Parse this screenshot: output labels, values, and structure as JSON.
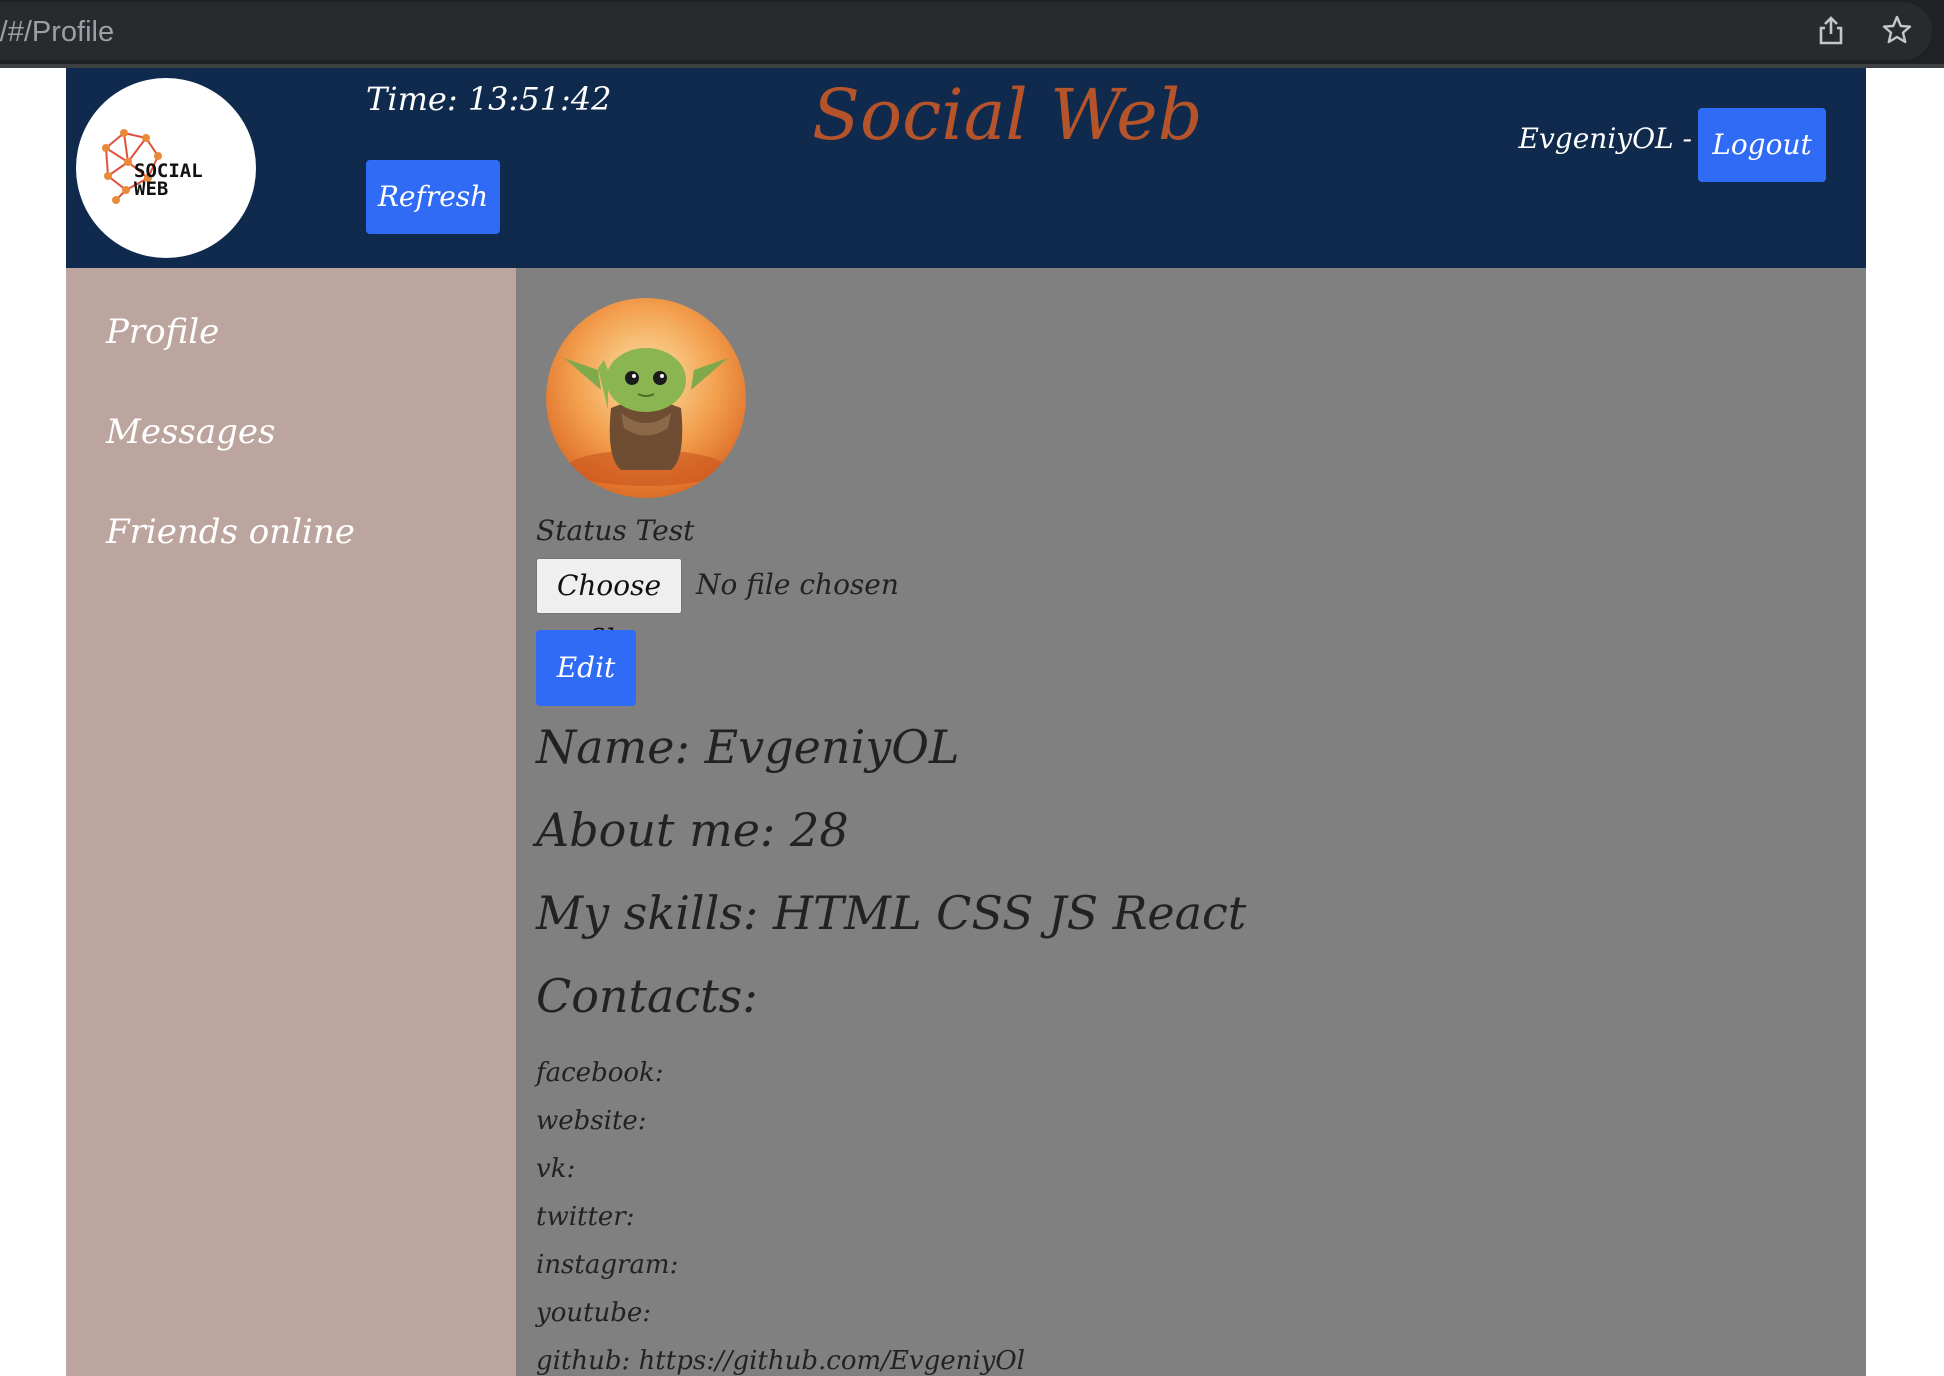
{
  "browser": {
    "url": ")/#/Profile",
    "share_icon": "share-icon",
    "bookmark_icon": "star-icon"
  },
  "header": {
    "logo_text_line1": "SOCIAL",
    "logo_text_line2": "WEB",
    "time_label": "Time: 13:51:42",
    "refresh_label": "Refresh",
    "site_title": "Social Web",
    "user_label": "EvgeniyOL -",
    "logout_label": "Logout"
  },
  "sidebar": {
    "items": [
      {
        "label": "Profile"
      },
      {
        "label": "Messages"
      },
      {
        "label": "Friends online"
      }
    ]
  },
  "profile": {
    "status": "Status Test",
    "choose_file_label": "Choose file",
    "file_status": "No file chosen",
    "edit_label": "Edit",
    "name_line": "Name: EvgeniyOL",
    "about_line": "About me: 28",
    "skills_line": "My skills: HTML CSS JS React",
    "contacts_heading": "Contacts:",
    "contacts": [
      "facebook:",
      "website:",
      "vk:",
      "twitter:",
      "instagram:",
      "youtube:",
      "github: https://github.com/EvgeniyOl"
    ]
  },
  "colors": {
    "header_bg": "#0f2a4c",
    "accent_button": "#2f6bf5",
    "title": "#b5532a",
    "sidebar_bg": "#bca59f",
    "content_bg": "#808080"
  }
}
